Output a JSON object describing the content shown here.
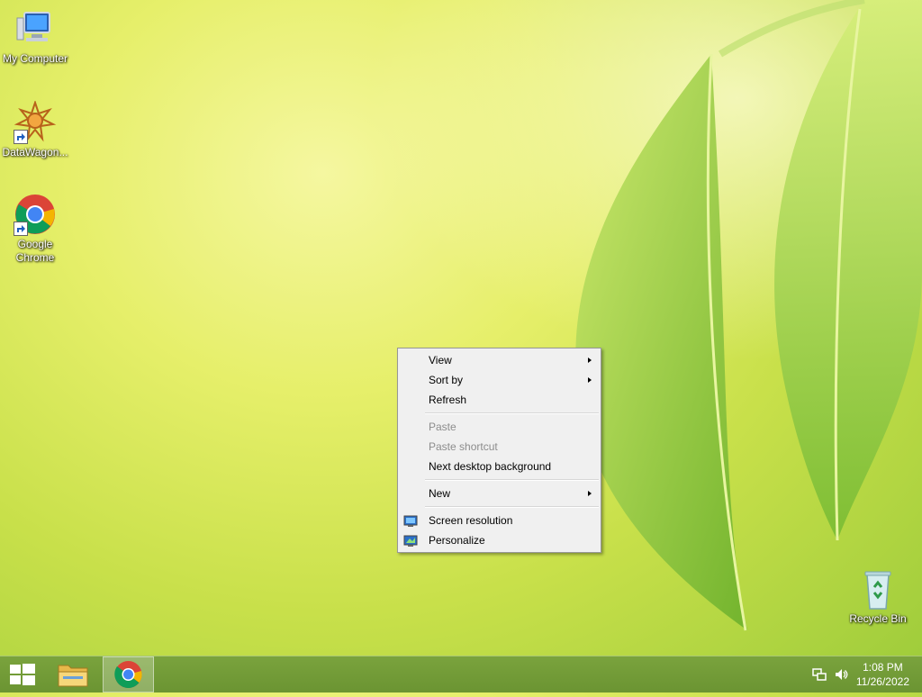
{
  "desktop": {
    "icons": [
      {
        "label": "My Computer",
        "icon": "computer-icon"
      },
      {
        "label": "DataWagon...",
        "icon": "datawagon-icon"
      },
      {
        "label": "Google Chrome",
        "icon": "chrome-icon"
      },
      {
        "label": "Recycle Bin",
        "icon": "recycle-bin-icon"
      }
    ]
  },
  "context_menu": {
    "items": [
      {
        "label": "View",
        "submenu": true,
        "enabled": true
      },
      {
        "label": "Sort by",
        "submenu": true,
        "enabled": true
      },
      {
        "label": "Refresh",
        "submenu": false,
        "enabled": true
      },
      {
        "label": "Paste",
        "submenu": false,
        "enabled": false
      },
      {
        "label": "Paste shortcut",
        "submenu": false,
        "enabled": false
      },
      {
        "label": "Next desktop background",
        "submenu": false,
        "enabled": true
      },
      {
        "label": "New",
        "submenu": true,
        "enabled": true
      },
      {
        "label": "Screen resolution",
        "submenu": false,
        "enabled": true,
        "icon": "screen-resolution-icon"
      },
      {
        "label": "Personalize",
        "submenu": false,
        "enabled": true,
        "icon": "personalize-icon"
      }
    ]
  },
  "taskbar": {
    "buttons": [
      {
        "icon": "windows-start-icon"
      },
      {
        "icon": "file-explorer-icon"
      },
      {
        "icon": "chrome-icon",
        "active": true
      }
    ],
    "tray": {
      "icons": [
        "network-icon",
        "volume-icon"
      ],
      "time": "1:08 PM",
      "date": "11/26/2022"
    }
  },
  "colors": {
    "taskbar": "#6e9634",
    "menu_bg": "#f0f0f0",
    "menu_disabled": "#8c8c8c"
  }
}
